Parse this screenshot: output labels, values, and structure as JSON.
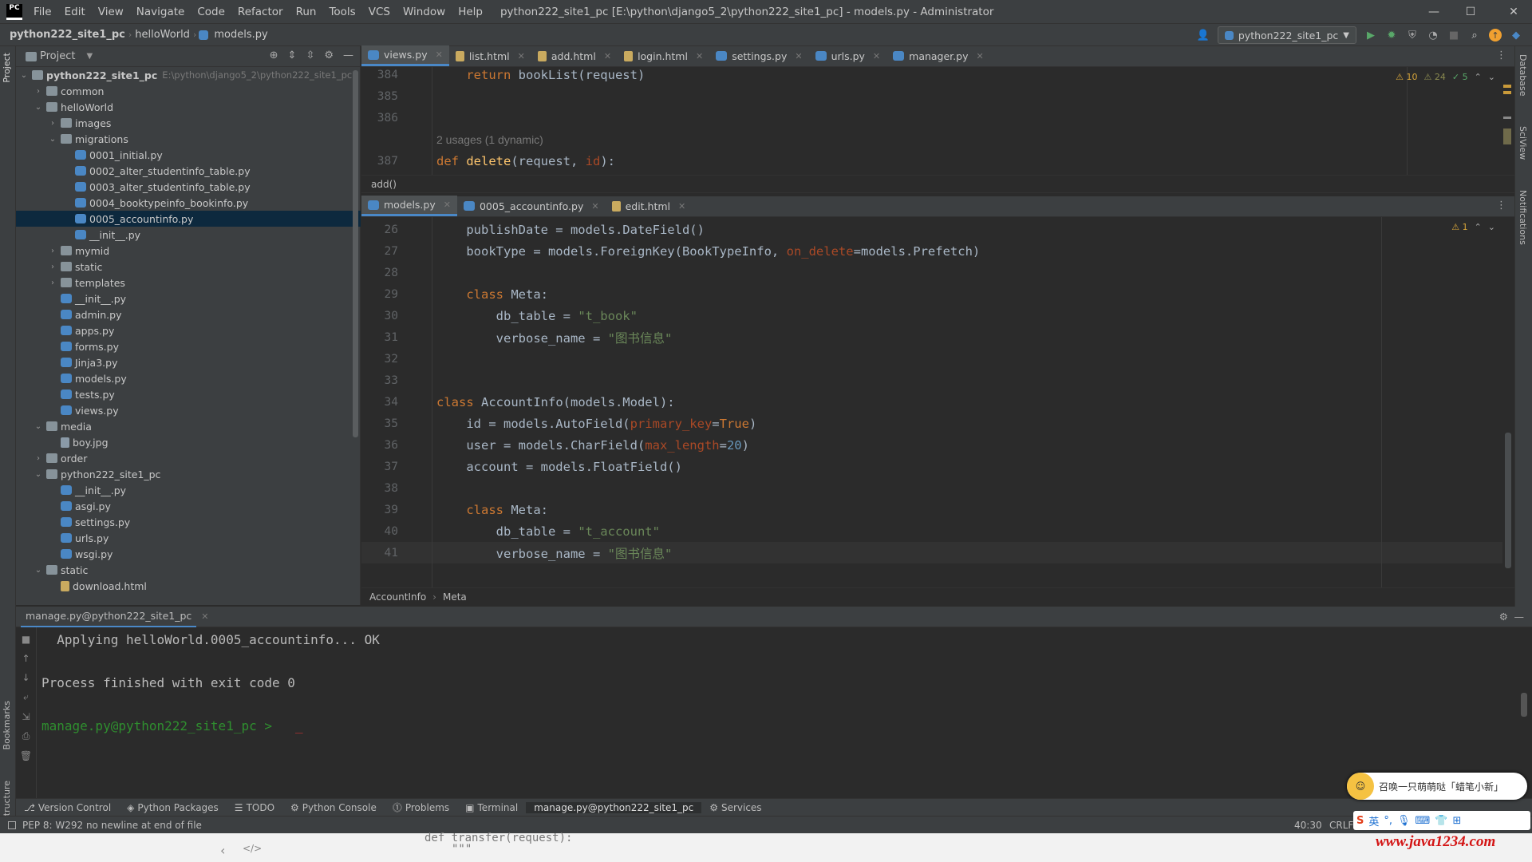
{
  "menu": [
    "File",
    "Edit",
    "View",
    "Navigate",
    "Code",
    "Refactor",
    "Run",
    "Tools",
    "VCS",
    "Window",
    "Help"
  ],
  "window_title": "python222_site1_pc [E:\\python\\django5_2\\python222_site1_pc] - models.py - Administrator",
  "breadcrumb": {
    "project": "python222_site1_pc",
    "folder": "helloWorld",
    "file": "models.py"
  },
  "run_config": "python222_site1_pc",
  "project_panel": {
    "title": "Project",
    "root": {
      "name": "python222_site1_pc",
      "path": "E:\\python\\django5_2\\python222_site1_pc"
    },
    "tree": [
      {
        "label": "common",
        "type": "folder",
        "depth": 1,
        "expand": "closed"
      },
      {
        "label": "helloWorld",
        "type": "folder",
        "depth": 1,
        "expand": "open"
      },
      {
        "label": "images",
        "type": "folder",
        "depth": 2,
        "expand": "closed"
      },
      {
        "label": "migrations",
        "type": "folder",
        "depth": 2,
        "expand": "open"
      },
      {
        "label": "0001_initial.py",
        "type": "py",
        "depth": 3
      },
      {
        "label": "0002_alter_studentinfo_table.py",
        "type": "py",
        "depth": 3
      },
      {
        "label": "0003_alter_studentinfo_table.py",
        "type": "py",
        "depth": 3
      },
      {
        "label": "0004_booktypeinfo_bookinfo.py",
        "type": "py",
        "depth": 3
      },
      {
        "label": "0005_accountinfo.py",
        "type": "py",
        "depth": 3,
        "selected": true
      },
      {
        "label": "__init__.py",
        "type": "py",
        "depth": 3
      },
      {
        "label": "mymid",
        "type": "folder",
        "depth": 2,
        "expand": "closed"
      },
      {
        "label": "static",
        "type": "folder",
        "depth": 2,
        "expand": "closed"
      },
      {
        "label": "templates",
        "type": "folder",
        "depth": 2,
        "expand": "closed"
      },
      {
        "label": "__init__.py",
        "type": "py",
        "depth": 2
      },
      {
        "label": "admin.py",
        "type": "py",
        "depth": 2
      },
      {
        "label": "apps.py",
        "type": "py",
        "depth": 2
      },
      {
        "label": "forms.py",
        "type": "py",
        "depth": 2
      },
      {
        "label": "Jinja3.py",
        "type": "py",
        "depth": 2
      },
      {
        "label": "models.py",
        "type": "py",
        "depth": 2
      },
      {
        "label": "tests.py",
        "type": "py",
        "depth": 2
      },
      {
        "label": "views.py",
        "type": "py",
        "depth": 2
      },
      {
        "label": "media",
        "type": "folder",
        "depth": 1,
        "expand": "open"
      },
      {
        "label": "boy.jpg",
        "type": "img",
        "depth": 2
      },
      {
        "label": "order",
        "type": "folder",
        "depth": 1,
        "expand": "closed"
      },
      {
        "label": "python222_site1_pc",
        "type": "folder",
        "depth": 1,
        "expand": "open"
      },
      {
        "label": "__init__.py",
        "type": "py",
        "depth": 2
      },
      {
        "label": "asgi.py",
        "type": "py",
        "depth": 2
      },
      {
        "label": "settings.py",
        "type": "py",
        "depth": 2
      },
      {
        "label": "urls.py",
        "type": "py",
        "depth": 2
      },
      {
        "label": "wsgi.py",
        "type": "py",
        "depth": 2
      },
      {
        "label": "static",
        "type": "folder",
        "depth": 1,
        "expand": "open"
      },
      {
        "label": "download.html",
        "type": "html",
        "depth": 2
      }
    ]
  },
  "top_tabs": [
    {
      "label": "views.py",
      "active": true,
      "kind": "py"
    },
    {
      "label": "list.html",
      "kind": "html"
    },
    {
      "label": "add.html",
      "kind": "html"
    },
    {
      "label": "login.html",
      "kind": "html"
    },
    {
      "label": "settings.py",
      "kind": "py"
    },
    {
      "label": "urls.py",
      "kind": "py"
    },
    {
      "label": "manager.py",
      "kind": "py"
    }
  ],
  "top_editor": {
    "inspections": {
      "warn": "10",
      "weak": "24",
      "ok": "5"
    },
    "lines": [
      {
        "n": "384",
        "parts": [
          [
            "kw",
            "    return "
          ],
          [
            "code",
            "bookList(request)"
          ]
        ]
      },
      {
        "n": "385",
        "parts": []
      },
      {
        "n": "386",
        "parts": []
      },
      {
        "n": "",
        "parts": [
          [
            "hint",
            "2 usages (1 dynamic)"
          ]
        ]
      },
      {
        "n": "387",
        "parts": [
          [
            "kw",
            "def "
          ],
          [
            "fn",
            "delete"
          ],
          [
            "code",
            "(request, "
          ],
          [
            "param",
            "id"
          ],
          [
            "code",
            "):"
          ]
        ]
      }
    ],
    "breadcrumb": "add()"
  },
  "bottom_tabs": [
    {
      "label": "models.py",
      "active": true,
      "kind": "py"
    },
    {
      "label": "0005_accountinfo.py",
      "kind": "py"
    },
    {
      "label": "edit.html",
      "kind": "html"
    }
  ],
  "bottom_editor": {
    "inspections": {
      "warn": "1"
    },
    "lines": [
      {
        "n": "26",
        "parts": [
          [
            "code",
            "    publishDate = models.DateField()"
          ]
        ]
      },
      {
        "n": "27",
        "parts": [
          [
            "code",
            "    bookType = models.ForeignKey(BookTypeInfo, "
          ],
          [
            "param",
            "on_delete"
          ],
          [
            "code",
            "=models.Prefetch)"
          ]
        ]
      },
      {
        "n": "28",
        "parts": []
      },
      {
        "n": "29",
        "parts": [
          [
            "kw",
            "    class "
          ],
          [
            "code",
            "Meta:"
          ]
        ]
      },
      {
        "n": "30",
        "parts": [
          [
            "code",
            "        db_table = "
          ],
          [
            "str",
            "\"t_book\""
          ]
        ]
      },
      {
        "n": "31",
        "parts": [
          [
            "code",
            "        verbose_name = "
          ],
          [
            "str",
            "\"图书信息\""
          ]
        ]
      },
      {
        "n": "32",
        "parts": []
      },
      {
        "n": "33",
        "parts": []
      },
      {
        "n": "34",
        "parts": [
          [
            "kw",
            "class "
          ],
          [
            "code",
            "AccountInfo(models.Model):"
          ]
        ]
      },
      {
        "n": "35",
        "parts": [
          [
            "code",
            "    id = models.AutoField("
          ],
          [
            "param",
            "primary_key"
          ],
          [
            "code",
            "="
          ],
          [
            "kw",
            "True"
          ],
          [
            "code",
            ")"
          ]
        ]
      },
      {
        "n": "36",
        "parts": [
          [
            "code",
            "    user = models.CharField("
          ],
          [
            "param",
            "max_length"
          ],
          [
            "code",
            "="
          ],
          [
            "num",
            "20"
          ],
          [
            "code",
            ")"
          ]
        ]
      },
      {
        "n": "37",
        "parts": [
          [
            "code",
            "    account = models.FloatField()"
          ]
        ]
      },
      {
        "n": "38",
        "parts": []
      },
      {
        "n": "39",
        "parts": [
          [
            "kw",
            "    class "
          ],
          [
            "code",
            "Meta:"
          ]
        ]
      },
      {
        "n": "40",
        "parts": [
          [
            "code",
            "        db_table = "
          ],
          [
            "str",
            "\"t_account\""
          ]
        ]
      },
      {
        "n": "41",
        "parts": [
          [
            "code",
            "        verbose_name = "
          ],
          [
            "str",
            "\"图书信息\""
          ]
        ]
      }
    ],
    "breadcrumb": [
      "AccountInfo",
      "Meta"
    ]
  },
  "run_panel": {
    "tab": "manage.py@python222_site1_pc",
    "output": [
      {
        "text": "  Applying helloWorld.0005_accountinfo... OK",
        "color": "#bbbbbb"
      },
      {
        "text": "",
        "color": "#bbbbbb"
      },
      {
        "text": "Process finished with exit code 0",
        "color": "#bbbbbb"
      },
      {
        "text": "",
        "color": "#bbbbbb"
      },
      {
        "text": "manage.py@python222_site1_pc > ",
        "color": "#2f8f2f"
      }
    ]
  },
  "tool_windows": [
    "Version Control",
    "Python Packages",
    "TODO",
    "Python Console",
    "Problems",
    "Terminal",
    "manage.py@python222_site1_pc",
    "Services"
  ],
  "status": {
    "message": "PEP 8: W292 no newline at end of file",
    "position": "40:30",
    "line_sep": "CRLF"
  },
  "left_strip": [
    "Project",
    "Bookmarks",
    "Structure"
  ],
  "right_strip": [
    "Database",
    "SciView",
    "Notifications"
  ],
  "watermark": {
    "popup": "召唤一只萌萌哒「蜡笔小新」",
    "site": "www.java1234.com"
  },
  "behind_window_code": [
    "def transfer(request):",
    "\"\"\""
  ]
}
